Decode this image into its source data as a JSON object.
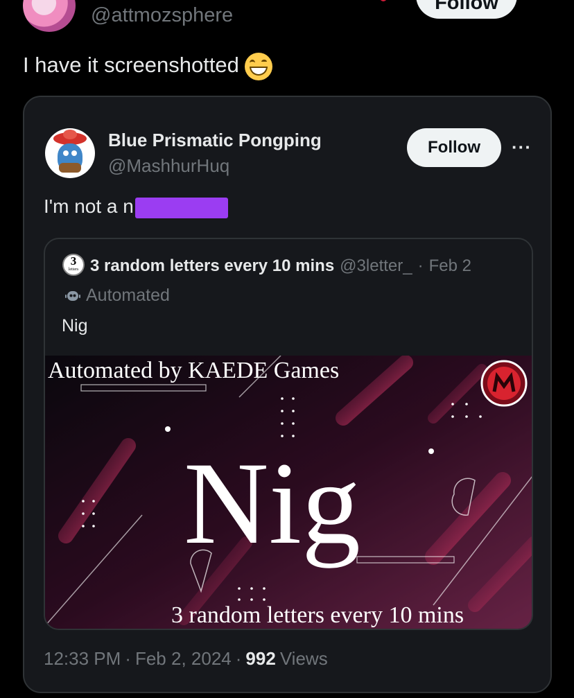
{
  "top": {
    "handle": "@attmozsphere",
    "follow_label": "Follow",
    "post_text": "I have it screenshotted",
    "emoji": "grinning-face-with-smiling-eyes"
  },
  "quote": {
    "display_name": "Blue Prismatic Pongping",
    "handle": "@MashhurHuq",
    "follow_label": "Follow",
    "more_label": "···",
    "text": "I'm not a n",
    "redaction_color": "#9b3df2",
    "nested": {
      "avatar_number": "3",
      "avatar_sub": "letters",
      "display_name": "3 random letters every 10 mins",
      "handle": "@3letter_",
      "separator": "·",
      "date": "Feb 2",
      "automated_label": "Automated",
      "text": "Nig",
      "image": {
        "header": "Automated by KAEDE Games",
        "word": "Nig",
        "footer": "3 random letters every 10 mins",
        "accent": "#e8336b"
      }
    },
    "footer": {
      "time": "12:33 PM",
      "date": "Feb 2, 2024",
      "separator": "·",
      "views_count": "992",
      "views_label": "Views"
    }
  }
}
